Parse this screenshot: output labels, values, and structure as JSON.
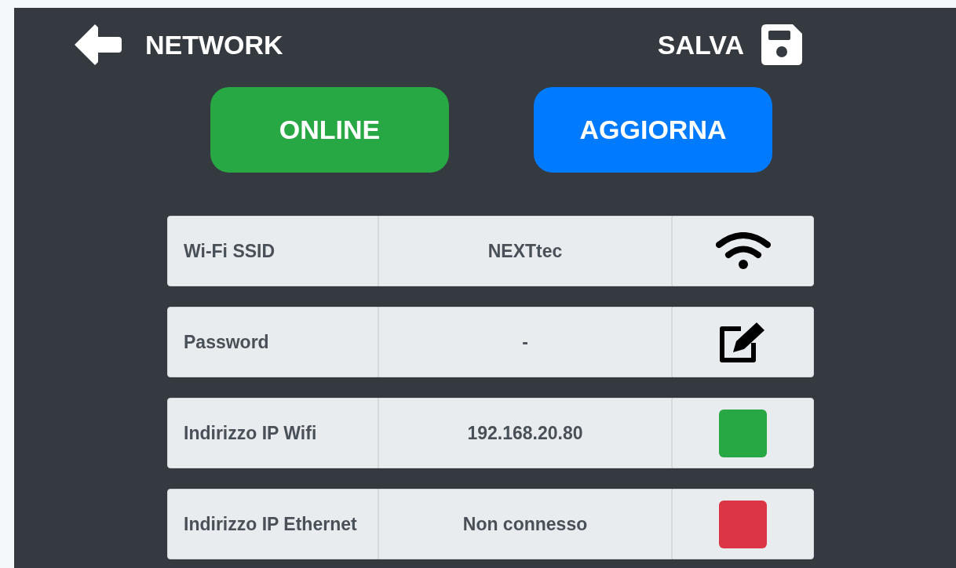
{
  "header": {
    "title": "NETWORK",
    "save_label": "SALVA"
  },
  "buttons": [
    {
      "label": "ONLINE",
      "color": "#28a745"
    },
    {
      "label": "AGGIORNA",
      "color": "#007bff"
    }
  ],
  "rows": [
    {
      "label": "Wi-Fi SSID",
      "value": "NEXTtec",
      "kind": "wifi"
    },
    {
      "label": "Password",
      "value": "-",
      "kind": "edit"
    },
    {
      "label": "Indirizzo IP Wifi",
      "value": "192.168.20.80",
      "kind": "status",
      "color": "#28a745"
    },
    {
      "label": "Indirizzo IP Ethernet",
      "value": "Non connesso",
      "kind": "status",
      "color": "#dc3545"
    }
  ]
}
